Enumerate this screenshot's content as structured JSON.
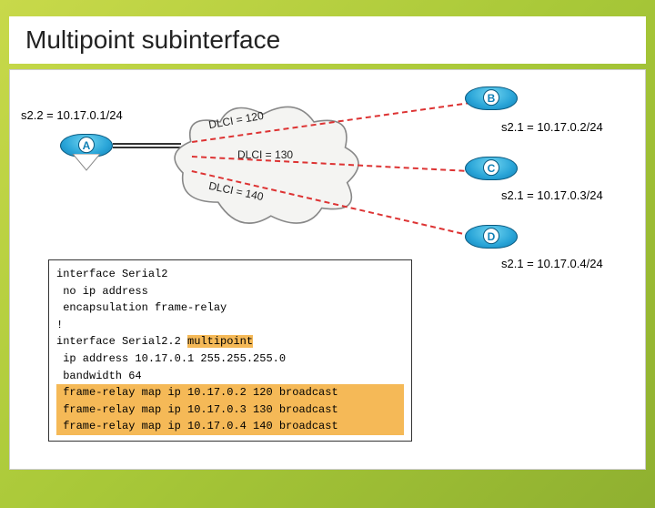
{
  "title": "Multipoint subinterface",
  "routers": {
    "A": {
      "label": "A",
      "addr": "s2.2 = 10.17.0.1/24"
    },
    "B": {
      "label": "B",
      "addr": "s2.1 = 10.17.0.2/24"
    },
    "C": {
      "label": "C",
      "addr": "s2.1 = 10.17.0.3/24"
    },
    "D": {
      "label": "D",
      "addr": "s2.1 = 10.17.0.4/24"
    }
  },
  "dlci": {
    "d120": "DLCI = 120",
    "d130": "DLCI = 130",
    "d140": "DLCI = 140"
  },
  "config": {
    "l1": "interface Serial2",
    "l2": " no ip address",
    "l3": " encapsulation frame-relay",
    "l4": "!",
    "l5a": "interface Serial2.2 ",
    "l5b": "multipoint",
    "l6": " ip address 10.17.0.1 255.255.255.0",
    "l7": " bandwidth 64",
    "l8": " frame-relay map ip 10.17.0.2 120 broadcast",
    "l9": " frame-relay map ip 10.17.0.3 130 broadcast",
    "l10": " frame-relay map ip 10.17.0.4 140 broadcast"
  }
}
